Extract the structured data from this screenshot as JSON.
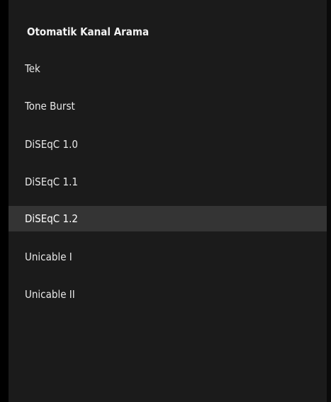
{
  "dialog": {
    "title": "Otomatik Kanal Arama",
    "selected_index": 4,
    "options": [
      {
        "label": "Tek"
      },
      {
        "label": "Tone Burst"
      },
      {
        "label": "DiSEqC 1.0"
      },
      {
        "label": "DiSEqC 1.1"
      },
      {
        "label": "DiSEqC 1.2"
      },
      {
        "label": "Unicable I"
      },
      {
        "label": "Unicable II"
      }
    ]
  }
}
